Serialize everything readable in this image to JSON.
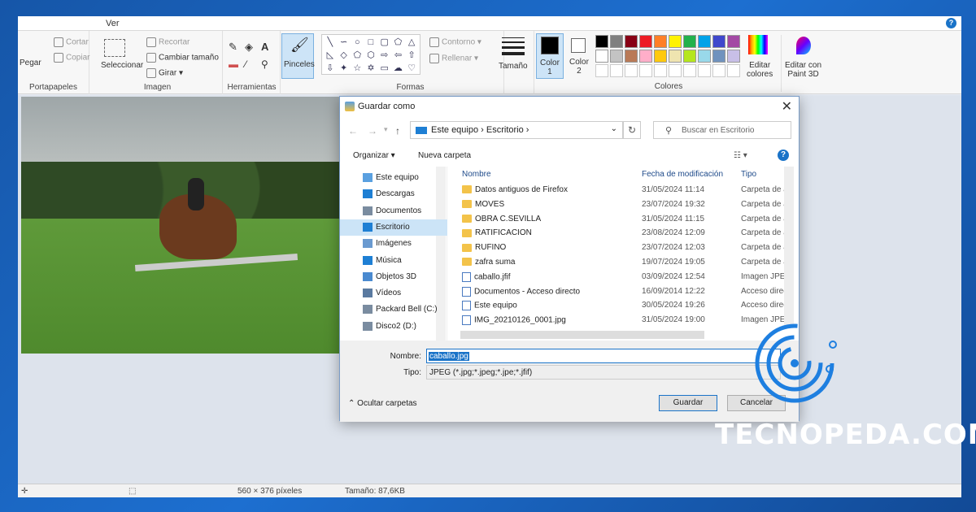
{
  "ribbon": {
    "tab_view": "Ver",
    "clipboard": {
      "cut": "Cortar",
      "copy": "Copiar",
      "paste": "Pegar",
      "label": "Portapapeles"
    },
    "image": {
      "select": "Seleccionar",
      "crop": "Recortar",
      "resize": "Cambiar tamaño",
      "rotate": "Girar",
      "label": "Imagen"
    },
    "tools": {
      "label": "Herramientas",
      "brushes": "Pinceles"
    },
    "shapes": {
      "outline": "Contorno",
      "fill": "Rellenar",
      "label": "Formas"
    },
    "size": "Tamaño",
    "color1": "Color\n1",
    "color2": "Color\n2",
    "colors_label": "Colores",
    "edit_colors": "Editar\ncolores",
    "edit_paint3d": "Editar con\nPaint 3D",
    "palette": [
      "#000000",
      "#7f7f7f",
      "#880015",
      "#ed1c24",
      "#ff7f27",
      "#fff200",
      "#22b14c",
      "#00a2e8",
      "#3f48cc",
      "#a349a4",
      "#ffffff",
      "#c3c3c3",
      "#b97a57",
      "#ffaec9",
      "#ffc90e",
      "#efe4b0",
      "#b5e61d",
      "#99d9ea",
      "#7092be",
      "#c8bfe7"
    ]
  },
  "status": {
    "dimensions": "560 × 376 píxeles",
    "size": "Tamaño: 87,6KB"
  },
  "dialog": {
    "title": "Guardar como",
    "address": "Este equipo  ›  Escritorio  ›",
    "search_placeholder": "Buscar en Escritorio",
    "organize": "Organizar ▾",
    "new_folder": "Nueva carpeta",
    "nav": [
      "Este equipo",
      "Descargas",
      "Documentos",
      "Escritorio",
      "Imágenes",
      "Música",
      "Objetos 3D",
      "Vídeos",
      "Packard Bell (C:)",
      "Disco2 (D:)"
    ],
    "nav_selected": 3,
    "columns": {
      "name": "Nombre",
      "date": "Fecha de modificación",
      "type": "Tipo"
    },
    "files": [
      {
        "name": "Datos antiguos de Firefox",
        "date": "31/05/2024 11:14",
        "type": "Carpeta de ar",
        "kind": "folder"
      },
      {
        "name": "MOVES",
        "date": "23/07/2024 19:32",
        "type": "Carpeta de ar",
        "kind": "folder"
      },
      {
        "name": "OBRA C.SEVILLA",
        "date": "31/05/2024 11:15",
        "type": "Carpeta de ar",
        "kind": "folder"
      },
      {
        "name": "RATIFICACION",
        "date": "23/08/2024 12:09",
        "type": "Carpeta de ar",
        "kind": "folder"
      },
      {
        "name": "RUFINO",
        "date": "23/07/2024 12:03",
        "type": "Carpeta de ar",
        "kind": "folder"
      },
      {
        "name": "zafra suma",
        "date": "19/07/2024 19:05",
        "type": "Carpeta de ar",
        "kind": "folder"
      },
      {
        "name": "caballo.jfif",
        "date": "03/09/2024 12:54",
        "type": "Imagen JPEG",
        "kind": "file"
      },
      {
        "name": "Documentos - Acceso directo",
        "date": "16/09/2014 12:22",
        "type": "Acceso direct",
        "kind": "file"
      },
      {
        "name": "Este equipo",
        "date": "30/05/2024 19:26",
        "type": "Acceso direct",
        "kind": "file"
      },
      {
        "name": "IMG_20210126_0001.jpg",
        "date": "31/05/2024 19:00",
        "type": "Imagen JPEG",
        "kind": "file"
      }
    ],
    "filename_label": "Nombre:",
    "filename": "caballo.jpg",
    "type_label": "Tipo:",
    "type_value": "JPEG (*.jpg;*.jpeg;*.jpe;*.jfif)",
    "hide_folders": "Ocultar carpetas",
    "save": "Guardar",
    "cancel": "Cancelar"
  },
  "brand": "TECNOPEDA.COM"
}
